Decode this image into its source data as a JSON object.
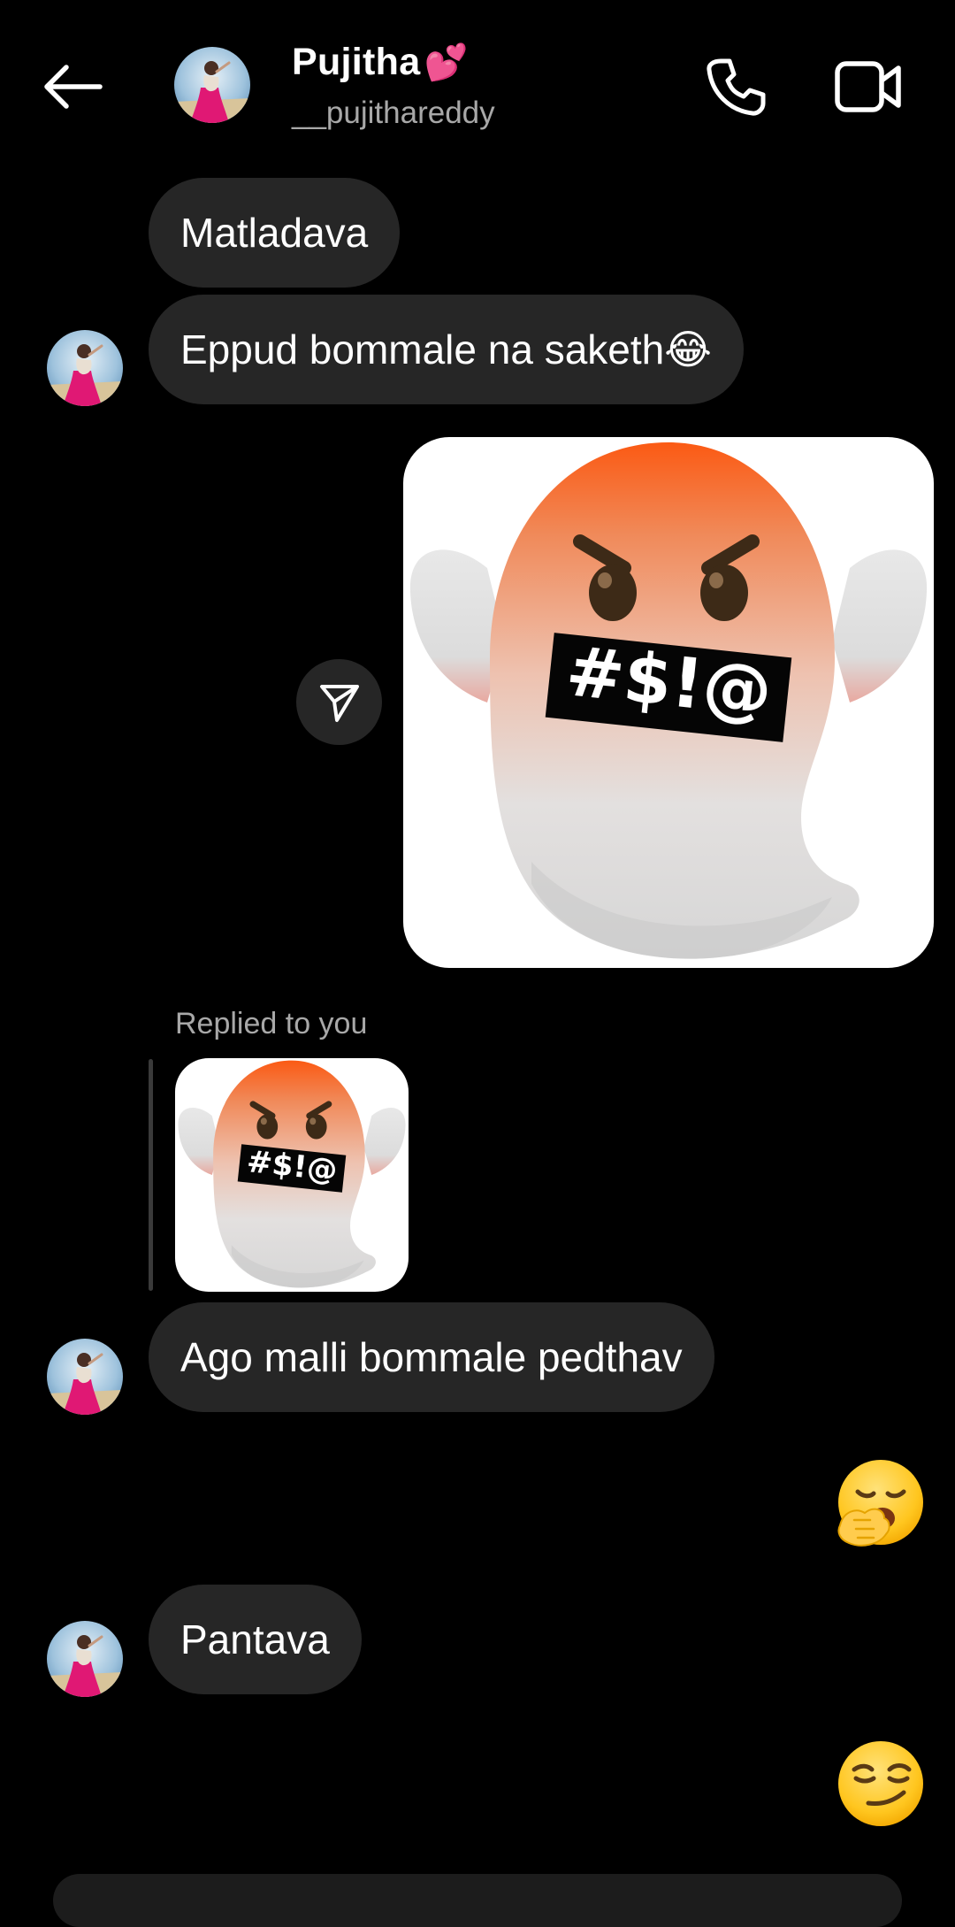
{
  "header": {
    "name": "Pujitha",
    "name_emoji": "💕",
    "username": "__pujithareddy"
  },
  "messages": {
    "m1": "Matladava",
    "m2": "Eppud bommale na saketh😂",
    "sticker_text": "#$!@",
    "replied_label": "Replied to you",
    "reply_sticker_text": "#$!@",
    "m3": "Ago malli bommale pedthav",
    "m4": "Pantava"
  },
  "colors": {
    "background": "#000000",
    "bubble": "#262626",
    "secondary_text": "#a8a8a8",
    "ghost_orange": "#f4631e"
  },
  "icons": {
    "back": "arrow-left-icon",
    "call": "phone-icon",
    "video": "video-camera-icon",
    "share": "paper-plane-icon",
    "reaction1": "yawning-face-emoji",
    "reaction2": "smirking-face-emoji"
  }
}
